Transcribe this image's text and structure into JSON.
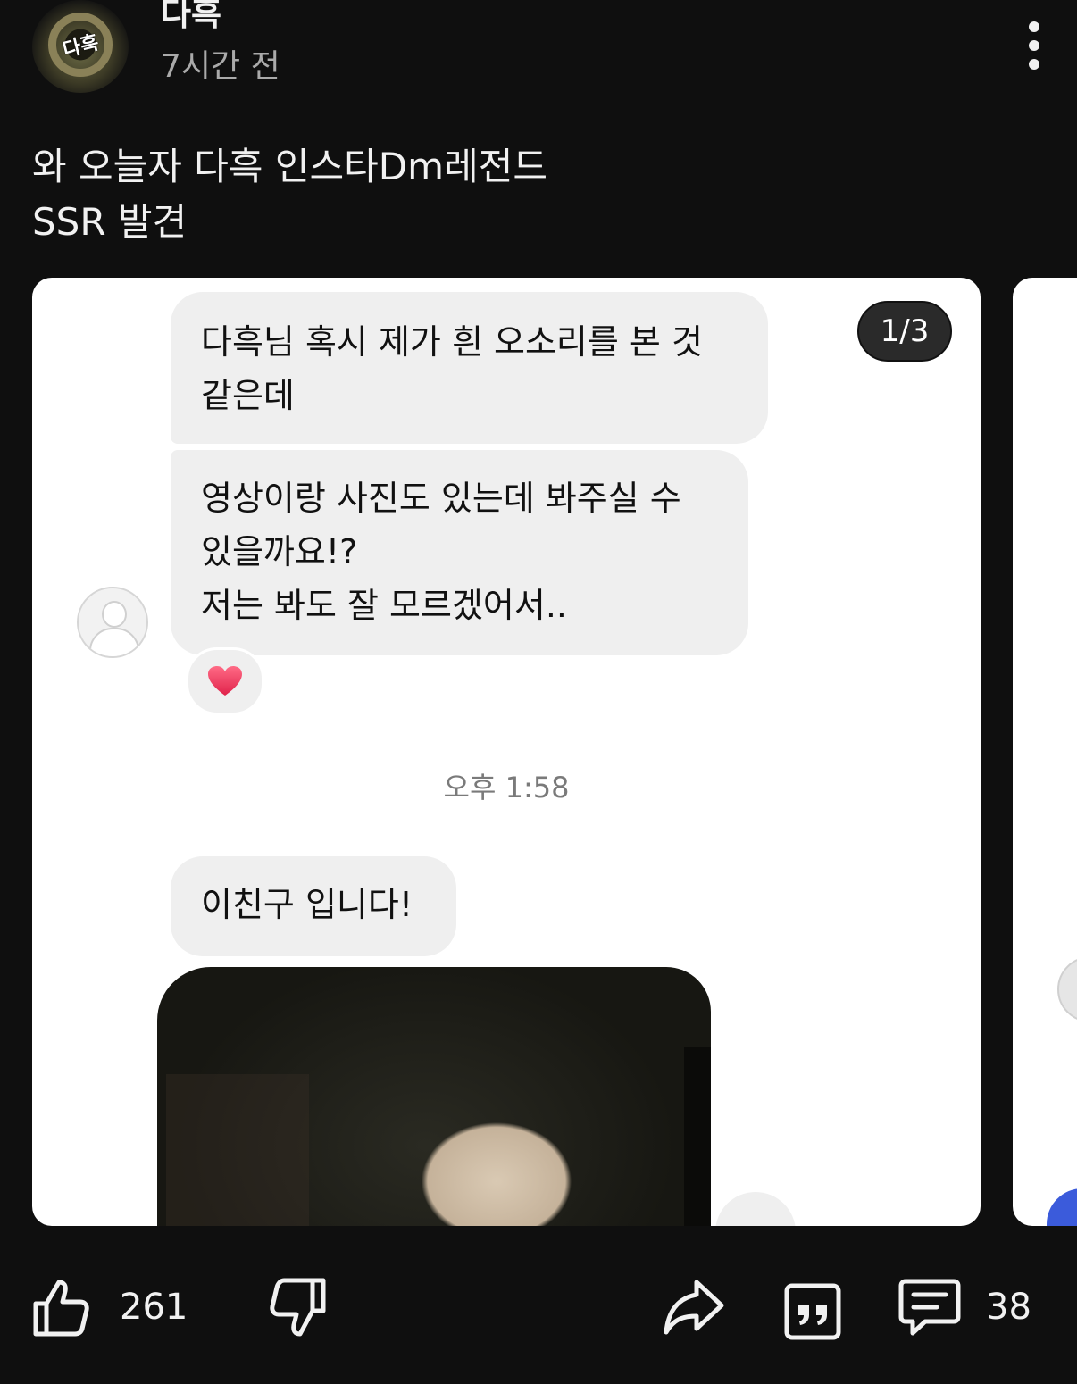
{
  "post": {
    "author": "다흑",
    "time_ago": "7시간 전",
    "avatar_logo_text": "다흑",
    "body_lines": [
      "와 오늘자 다흑 인스타Dm레전드",
      "SSR 발견"
    ]
  },
  "carousel": {
    "counter": "1/3",
    "messages": [
      {
        "lines": [
          "다흑님 혹시 제가 흰 오소리를 본 것",
          "같은데"
        ]
      },
      {
        "lines": [
          "영상이랑 사진도 있는데 봐주실 수",
          "있을까요!?",
          "저는 봐도 잘 모르겠어서.."
        ]
      },
      {
        "lines": [
          "이친구 입니다!"
        ]
      }
    ],
    "reaction_icon": "heart-icon",
    "timestamp": "오후 1:58"
  },
  "actions": {
    "like_count": "261",
    "comment_count": "38",
    "icons": [
      "thumb-up-icon",
      "thumb-down-icon",
      "share-icon",
      "quote-icon",
      "comment-icon"
    ]
  },
  "colors": {
    "background": "#0f0f0f",
    "text": "#f1f1f1",
    "secondary_text": "#aaaaaa",
    "bubble": "#efefef",
    "heart": "#e8355b"
  }
}
